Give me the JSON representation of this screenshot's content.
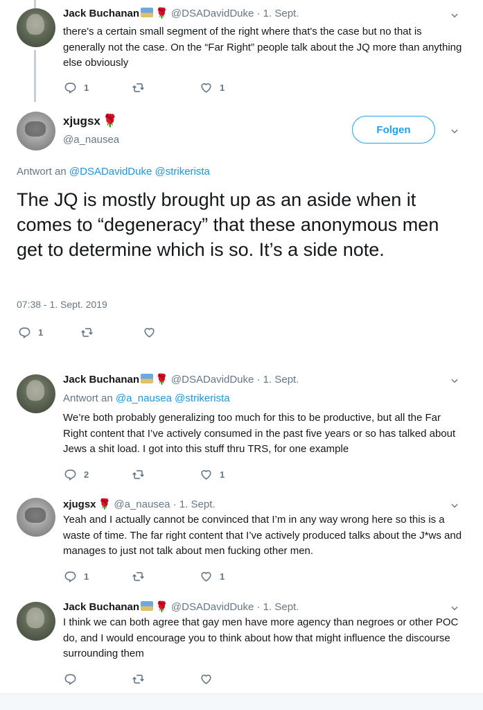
{
  "tweets": [
    {
      "name": "Jack Buchanan",
      "handle": "@DSADavidDuke",
      "date": "· 1. Sept.",
      "text": "there's a certain small segment of the right where that's the case but no that is generally not the case. On the “Far Right” people talk about the JQ more than anything else obviously",
      "replies": "1",
      "retweets": "",
      "likes": "1"
    },
    {
      "name": "xjugsx",
      "handle": "@a_nausea",
      "follow_label": "Folgen",
      "reply_prefix": "Antwort an",
      "reply_handles": "@DSADavidDuke @strikerista",
      "text": "The JQ is mostly brought up as an aside when it comes to “degeneracy” that these anonymous men get to determine which is so. It’s a side note.",
      "timestamp": "07:38 - 1. Sept. 2019",
      "replies": "1",
      "retweets": "",
      "likes": ""
    },
    {
      "name": "Jack Buchanan",
      "handle": "@DSADavidDuke",
      "date": "· 1. Sept.",
      "reply_prefix": "Antwort an",
      "reply_handles": "@a_nausea @strikerista",
      "text": "We’re both probably generalizing too much for this to be productive, but all the Far Right content that I’ve actively consumed in the past five years or so has talked about Jews a shit load. I got into this stuff thru TRS, for one example",
      "replies": "2",
      "retweets": "",
      "likes": "1"
    },
    {
      "name": "xjugsx",
      "handle": "@a_nausea",
      "date": "· 1. Sept.",
      "text": "Yeah and I actually cannot be convinced that I’m in any way wrong here so this is a waste of time. The far right content that I’ve actively produced talks about the J*ws and manages to just not talk about men fucking other men.",
      "replies": "1",
      "retweets": "",
      "likes": "1"
    },
    {
      "name": "Jack Buchanan",
      "handle": "@DSADavidDuke",
      "date": "· 1. Sept.",
      "text": "I think we can both agree that gay men have more agency than negroes or other POC do, and I would encourage you to think about how that might influence the discourse surrounding them",
      "replies": "",
      "retweets": "",
      "likes": ""
    }
  ],
  "icons": {
    "reply": "reply-icon",
    "retweet": "retweet-icon",
    "like": "heart-icon",
    "caret": "chevron-down-icon",
    "rose": "rose-emoji",
    "flag": "flag-emoji"
  },
  "colors": {
    "link": "#1b95e0",
    "muted": "#657786",
    "follow": "#1da1f2",
    "rose": "#c0152c"
  }
}
